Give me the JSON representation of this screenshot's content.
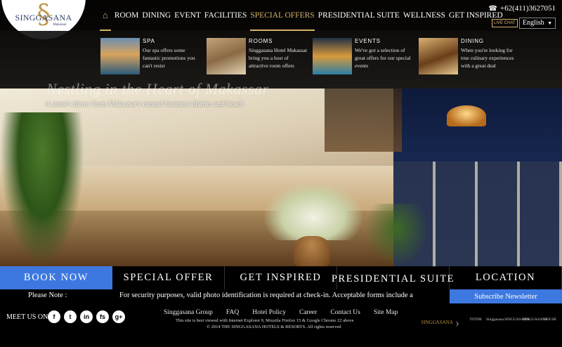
{
  "header": {
    "logo_text": "SINGGASANA",
    "logo_sub": "Makassar",
    "phone": "+62(411)3627051",
    "live_chat": "LIVE CHAT",
    "language": "English"
  },
  "nav": {
    "items": [
      "ROOM",
      "DINING",
      "EVENT",
      "FACILITIES",
      "SPECIAL OFFERS",
      "PRESIDENTIAL SUITE",
      "WELLNESS",
      "GET INSPIRED"
    ],
    "active": "SPECIAL OFFERS"
  },
  "offers": [
    {
      "title": "SPA",
      "desc": "Our spa offers some fantastic promotions you can't resist"
    },
    {
      "title": "ROOMS",
      "desc": "Singgasana Hotel Makassar bring you a host of attractive room offers"
    },
    {
      "title": "EVENTS",
      "desc": "We've got a selection of great offers for our special events"
    },
    {
      "title": "DINING",
      "desc": "When you're looking for true culinary experiences with a great deal"
    }
  ],
  "hero": {
    "tagline": "Nestling in the Heart of Makassar",
    "subtitle": "A stone's throw from Makassar's central business district and beach"
  },
  "quickbar": {
    "book": "BOOK NOW",
    "special": "SPECIAL OFFER",
    "inspired": "GET INSPIRED",
    "presidential": "PRESIDENTIAL SUITE",
    "location": "LOCATION"
  },
  "notice": {
    "label": "Please Note :",
    "message": "For security purposes, valid photo identification is required at check-in. Acceptable forms include a"
  },
  "subscribe": "Subscribe Newsletter",
  "footer": {
    "meet_us": "MEET US ON",
    "social": [
      "f",
      "t",
      "in",
      "fs",
      "g+"
    ],
    "links": [
      "Singgasana Group",
      "FAQ",
      "Hotel Policy",
      "Career",
      "Contact Us",
      "Site Map"
    ],
    "browser_note": "This site is best viewed with Internet Explorer 9, Mozzila Firefox 15 & Google Chrome 22 above",
    "copyright": "© 2014 THE SINGGASANA HOTELS & RESORTS. All rights reserved",
    "brand_main": "SINGGASANA",
    "brands": [
      "TOTIM",
      "Singgasana",
      "SINGGASANA",
      "SINGGASANA",
      "HOUSE"
    ]
  },
  "colors": {
    "accent": "#d4b26a",
    "blue": "#3d78e0"
  }
}
